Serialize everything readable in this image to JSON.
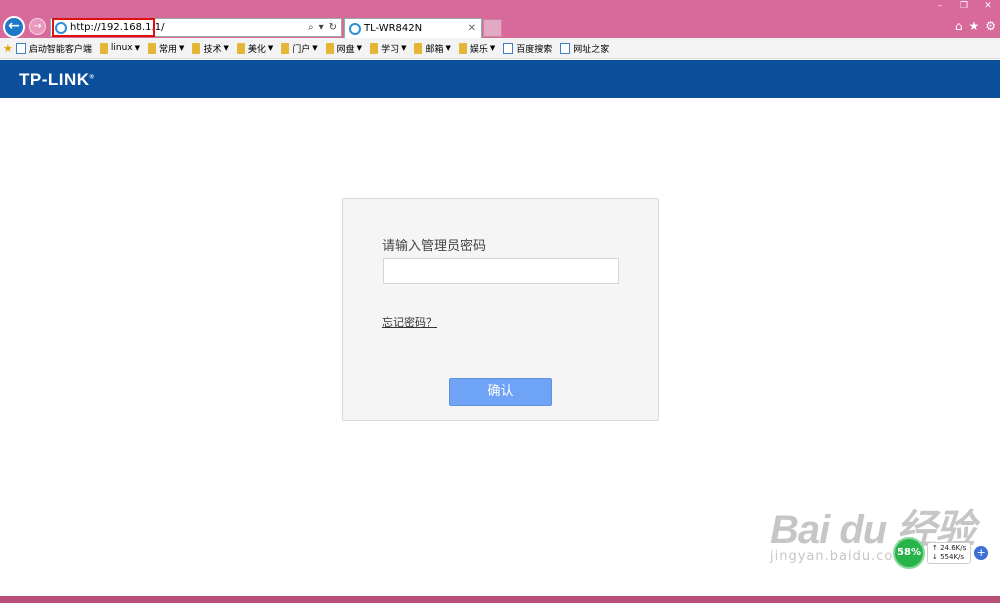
{
  "browser": {
    "window_controls": [
      "–",
      "❐",
      "✕"
    ],
    "back_glyph": "←",
    "forward_glyph": "→",
    "address_url": "http://192.168.1.1/",
    "address_tools": [
      "⌕",
      "▾",
      "↻"
    ],
    "tab_title": "TL-WR842N",
    "tab_close": "✕",
    "right_tools": [
      "⌂",
      "★",
      "⚙"
    ]
  },
  "favorites": [
    {
      "label": "启动智能客户端",
      "icon": "page-icon",
      "dropdown": false
    },
    {
      "label": "linux",
      "icon": "folder-icon",
      "dropdown": true
    },
    {
      "label": "常用",
      "icon": "folder-icon",
      "dropdown": true
    },
    {
      "label": "技术",
      "icon": "folder-icon",
      "dropdown": true
    },
    {
      "label": "美化",
      "icon": "folder-icon",
      "dropdown": true
    },
    {
      "label": "门户",
      "icon": "folder-icon",
      "dropdown": true
    },
    {
      "label": "网盘",
      "icon": "folder-icon",
      "dropdown": true
    },
    {
      "label": "学习",
      "icon": "folder-icon",
      "dropdown": true
    },
    {
      "label": "邮箱",
      "icon": "folder-icon",
      "dropdown": true
    },
    {
      "label": "娱乐",
      "icon": "folder-icon",
      "dropdown": true
    },
    {
      "label": "百度搜索",
      "icon": "baidu-icon",
      "dropdown": false
    },
    {
      "label": "网址之家",
      "icon": "page-icon",
      "dropdown": false
    }
  ],
  "page": {
    "logo": "TP-LINK",
    "logo_mark": "®",
    "password_label": "请输入管理员密码",
    "password_value": "",
    "forgot_link": "忘记密码？",
    "confirm_button": "确认"
  },
  "watermark": {
    "main": "Bai du 经验",
    "sub": "jingyan.baidu.com"
  },
  "net_widget": {
    "percent": "58%",
    "up": "↑ 24.6K/s",
    "down": "↓ 554K/s",
    "plus": "+"
  },
  "colors": {
    "chrome": "#d76a9a",
    "brand_bar": "#0b4f9b",
    "confirm_button": "#6ea3f5",
    "address_highlight": "#e01010"
  }
}
